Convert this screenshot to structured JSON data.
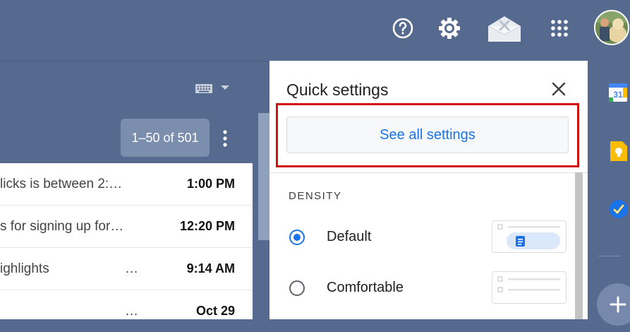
{
  "header": {
    "icons": [
      "help-icon",
      "settings-icon",
      "offline-mail-icon",
      "apps-grid-icon",
      "avatar"
    ]
  },
  "toolbar": {
    "pagination": "1–50 of 501"
  },
  "emails": [
    {
      "snippet": "licks is between 2:…",
      "time": "1:00 PM"
    },
    {
      "snippet": "s for signing up for…",
      "time": "12:20 PM"
    },
    {
      "snippet": "ighlights",
      "dots": "…",
      "time": "9:14 AM"
    },
    {
      "snippet": "",
      "dots": "…",
      "time": "Oct 29"
    }
  ],
  "quick_settings": {
    "title": "Quick settings",
    "see_all": "See all settings",
    "density_label": "DENSITY",
    "options": [
      {
        "label": "Default",
        "selected": true
      },
      {
        "label": "Comfortable",
        "selected": false
      }
    ]
  },
  "side_rail": {
    "icons": [
      "calendar-icon",
      "keep-icon",
      "tasks-icon"
    ],
    "calendar_day": "31"
  },
  "colors": {
    "background": "#566a8f",
    "accent": "#1a73e8",
    "highlight": "#d20f0f"
  }
}
